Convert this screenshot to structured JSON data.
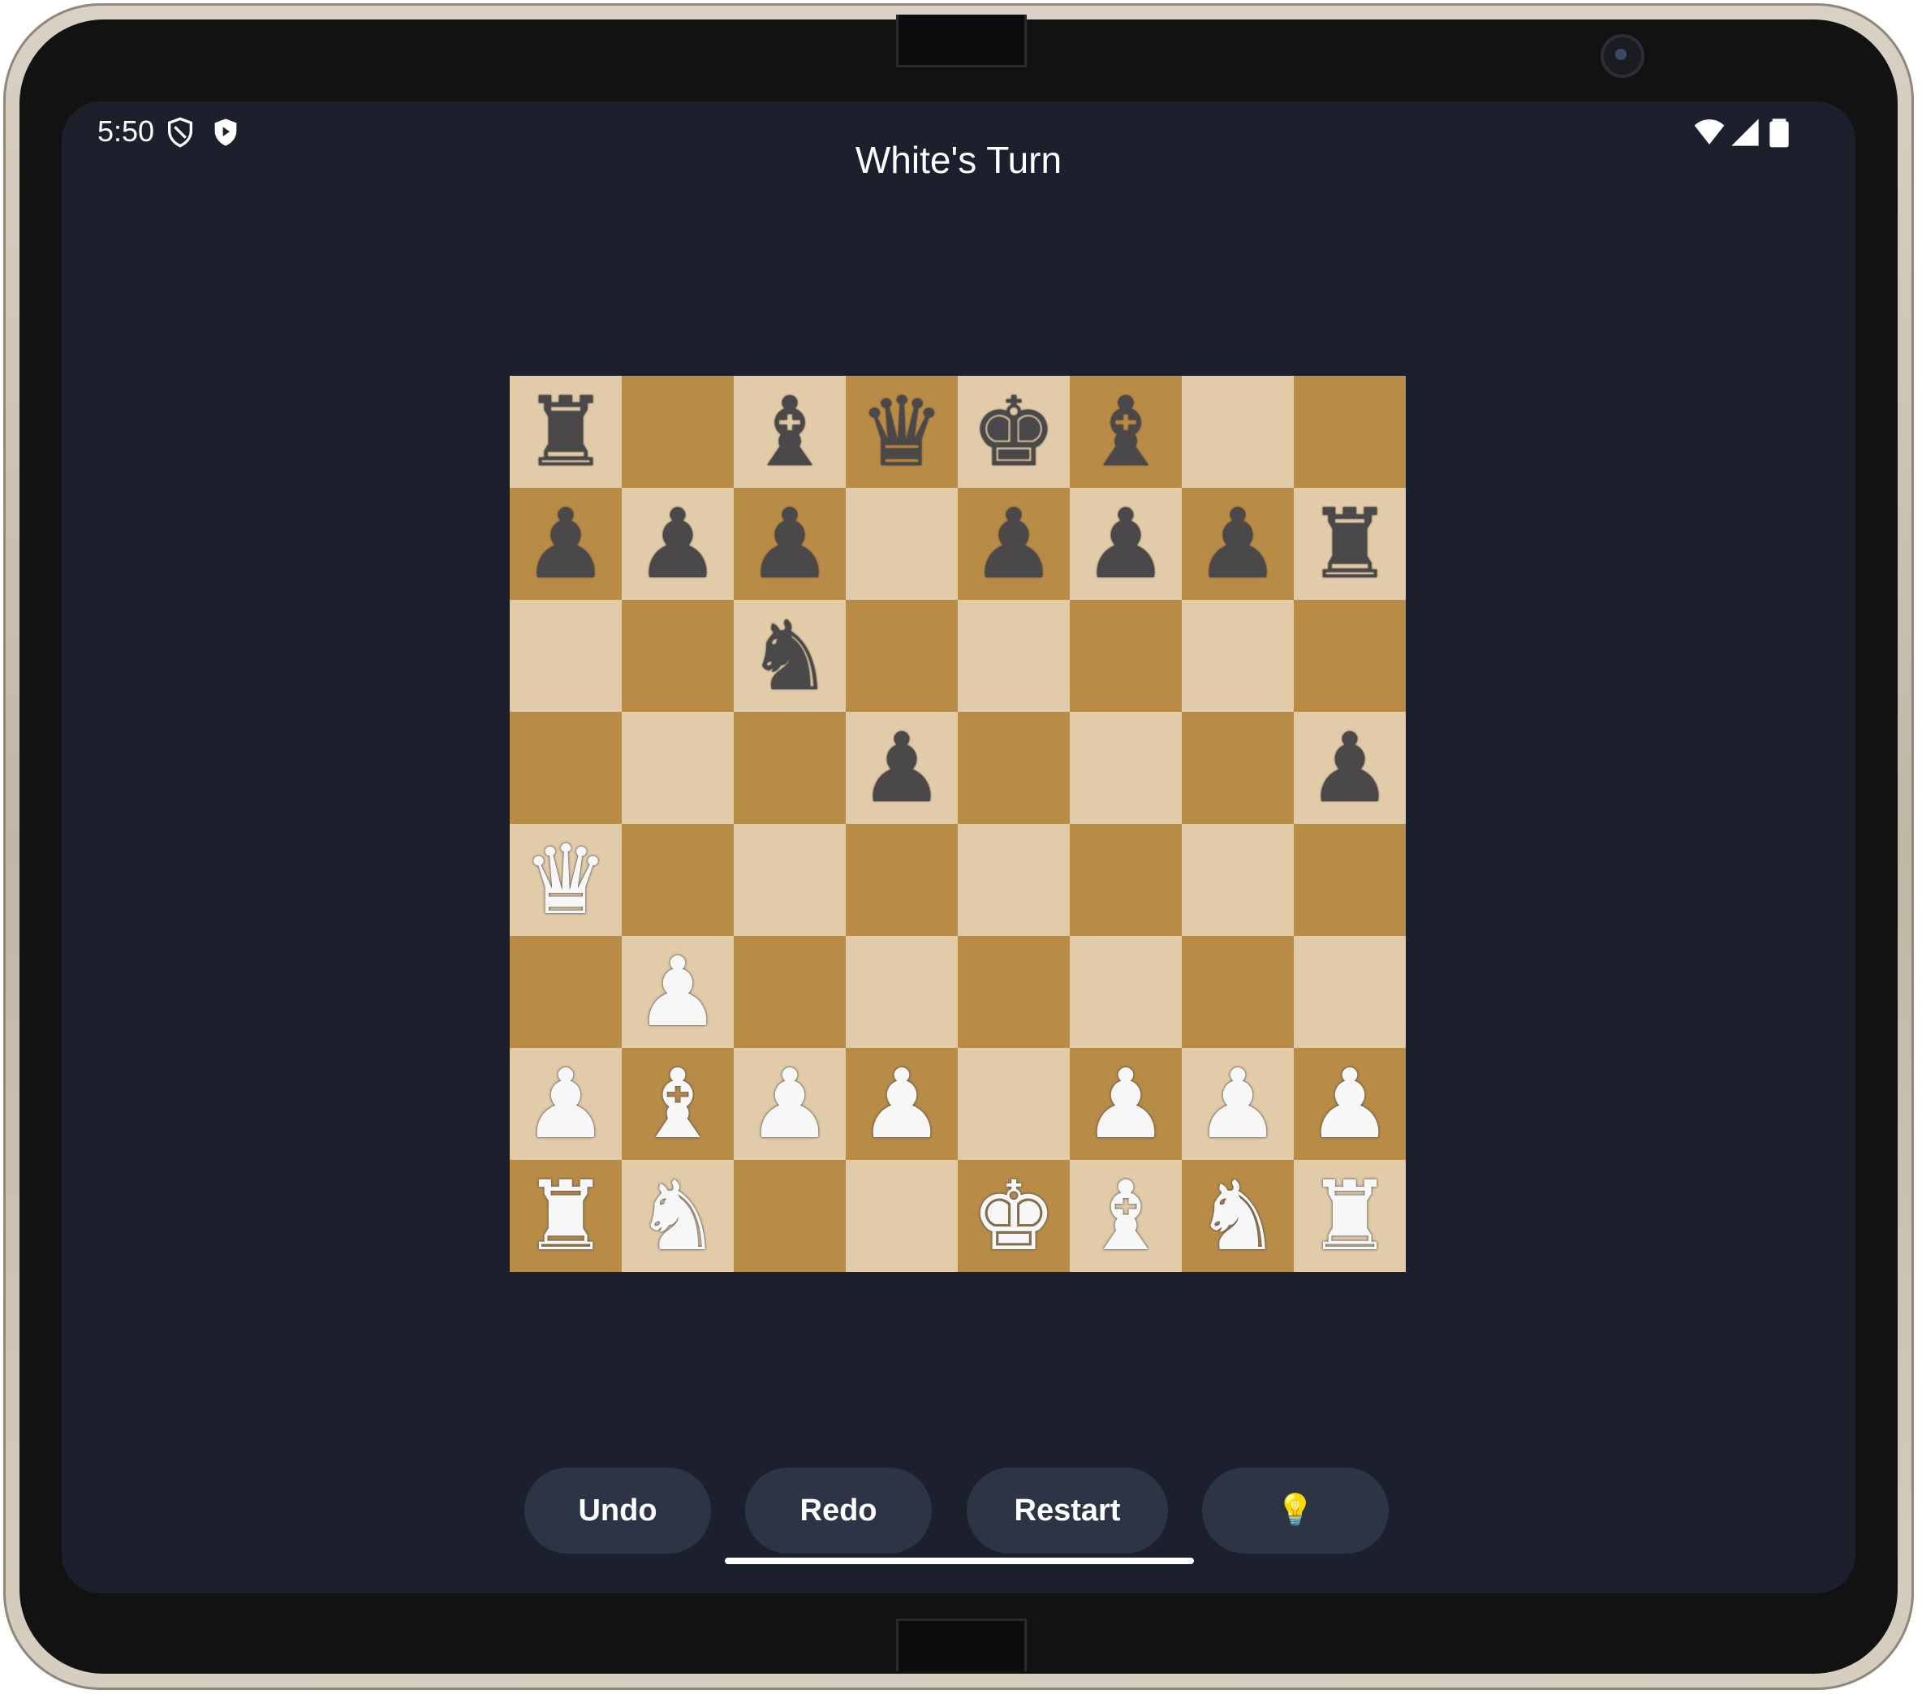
{
  "status_bar": {
    "time": "5:50",
    "left_icons": [
      "shield-icon",
      "play-protect-icon"
    ],
    "right_icons": [
      "wifi-icon",
      "signal-icon",
      "battery-icon"
    ]
  },
  "header": {
    "title": "White's Turn"
  },
  "board": {
    "rows": [
      [
        "bR",
        "",
        "bB",
        "bQ",
        "bK",
        "bB",
        "",
        ""
      ],
      [
        "bP",
        "bP",
        "bP",
        "",
        "bP",
        "bP",
        "bP",
        "bR"
      ],
      [
        "",
        "",
        "bN",
        "",
        "",
        "",
        "",
        ""
      ],
      [
        "",
        "",
        "",
        "bP",
        "",
        "",
        "",
        "bP"
      ],
      [
        "wQ",
        "",
        "",
        "",
        "",
        "",
        "",
        ""
      ],
      [
        "",
        "wP",
        "",
        "",
        "",
        "",
        "",
        ""
      ],
      [
        "wP",
        "wB",
        "wP",
        "wP",
        "",
        "wP",
        "wP",
        "wP"
      ],
      [
        "wR",
        "wN",
        "",
        "",
        "wK",
        "wB",
        "wN",
        "wR"
      ]
    ],
    "colors": {
      "light": "#e2cba8",
      "dark": "#b88b47"
    }
  },
  "controls": {
    "undo_label": "Undo",
    "redo_label": "Redo",
    "restart_label": "Restart",
    "hint_label": "💡"
  }
}
